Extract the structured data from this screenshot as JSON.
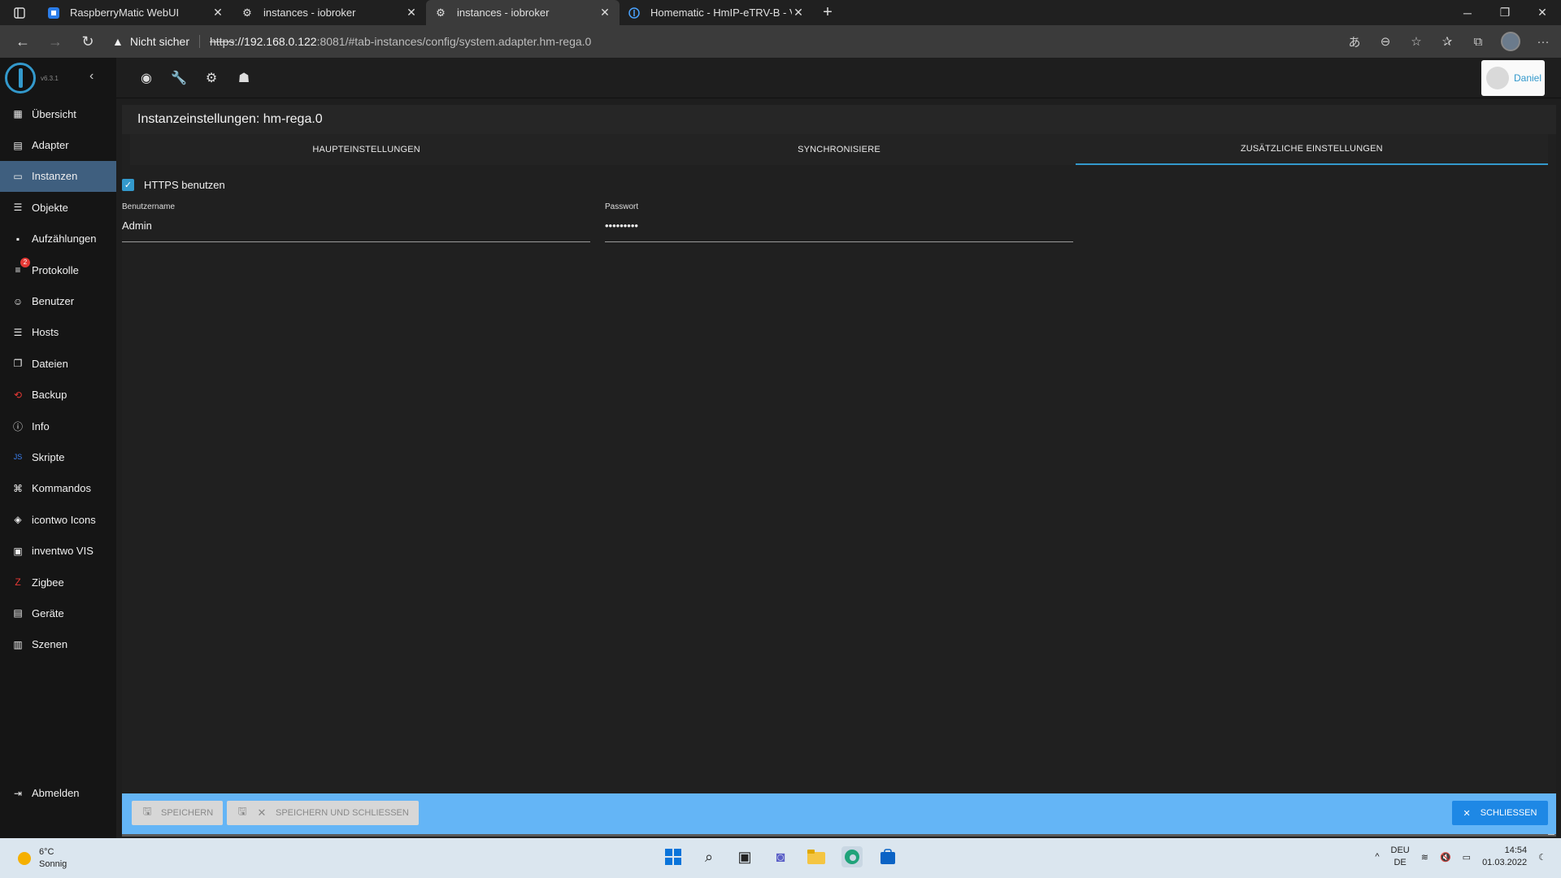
{
  "browser": {
    "tabs": [
      {
        "title": "RaspberryMatic WebUI",
        "active": false,
        "icon": "raspberrymatic-icon"
      },
      {
        "title": "instances - iobroker",
        "active": false,
        "icon": "iobroker-gear-icon"
      },
      {
        "title": "instances - iobroker",
        "active": true,
        "icon": "iobroker-gear-icon"
      },
      {
        "title": "Homematic - HmIP-eTRV-B - Ve",
        "active": false,
        "icon": "homematic-icon"
      }
    ],
    "security_label": "Nicht sicher",
    "url_scheme": "https",
    "url_host": "://192.168.0.122",
    "url_rest": ":8081/#tab-instances/config/system.adapter.hm-rega.0"
  },
  "app": {
    "version": "v6.3.1",
    "sidebar": [
      {
        "label": "Übersicht",
        "icon": "grid-icon"
      },
      {
        "label": "Adapter",
        "icon": "store-icon"
      },
      {
        "label": "Instanzen",
        "icon": "instances-icon",
        "active": true
      },
      {
        "label": "Objekte",
        "icon": "list-icon"
      },
      {
        "label": "Aufzählungen",
        "icon": "enum-icon"
      },
      {
        "label": "Protokolle",
        "icon": "log-icon",
        "badge": "2"
      },
      {
        "label": "Benutzer",
        "icon": "user-icon"
      },
      {
        "label": "Hosts",
        "icon": "hosts-icon"
      },
      {
        "label": "Dateien",
        "icon": "files-icon"
      },
      {
        "label": "Backup",
        "icon": "backup-icon"
      },
      {
        "label": "Info",
        "icon": "info-icon"
      },
      {
        "label": "Skripte",
        "icon": "scripts-icon"
      },
      {
        "label": "Kommandos",
        "icon": "commands-icon"
      },
      {
        "label": "icontwo Icons",
        "icon": "icontwo-icon"
      },
      {
        "label": "inventwo VIS",
        "icon": "inventwo-icon"
      },
      {
        "label": "Zigbee",
        "icon": "zigbee-icon"
      },
      {
        "label": "Geräte",
        "icon": "devices-icon"
      },
      {
        "label": "Szenen",
        "icon": "scenes-icon"
      }
    ],
    "logout_label": "Abmelden",
    "user_name": "Daniel",
    "page_title": "Instanzeinstellungen: hm-rega.0",
    "tabs": [
      {
        "label": "HAUPTEINSTELLUNGEN",
        "active": false
      },
      {
        "label": "SYNCHRONISIERE",
        "active": false
      },
      {
        "label": "ZUSÄTZLICHE EINSTELLUNGEN",
        "active": true
      }
    ],
    "form": {
      "https_label": "HTTPS benutzen",
      "https_checked": true,
      "username_label": "Benutzername",
      "username_value": "Admin",
      "password_label": "Passwort",
      "password_value": "•••••••••"
    },
    "footer": {
      "save_label": "SPEICHERN",
      "save_close_label": "SPEICHERN UND SCHLIESSEN",
      "close_label": "SCHLIESSEN"
    }
  },
  "taskbar": {
    "temperature": "6°C",
    "weather": "Sonnig",
    "lang_top": "DEU",
    "lang_bottom": "DE",
    "time": "14:54",
    "date": "01.03.2022"
  },
  "colors": {
    "accent": "#3399cc",
    "active_sidebar": "#3f5f7f",
    "footer_bg": "#64b5f6",
    "close_button": "#1e88e5"
  }
}
